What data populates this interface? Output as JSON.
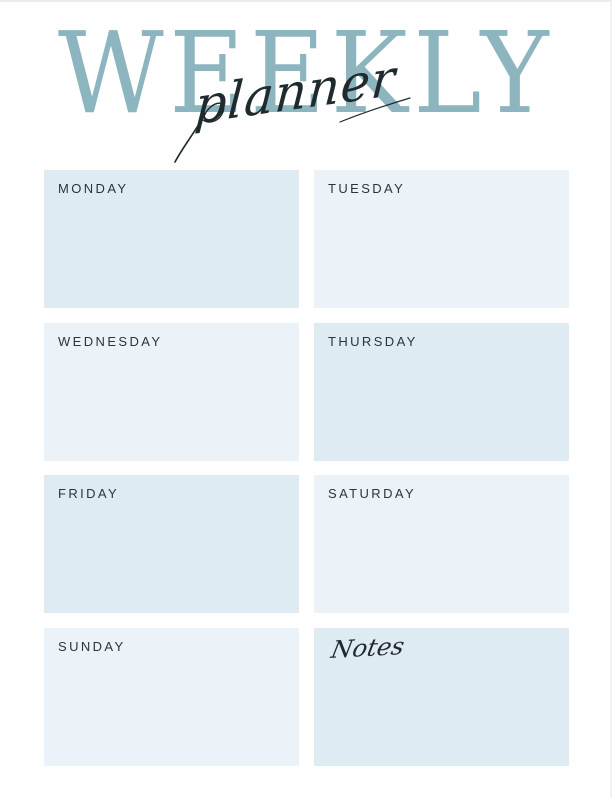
{
  "header": {
    "title": "WEEKLY",
    "subtitle": "planner"
  },
  "days": {
    "monday": "MONDAY",
    "tuesday": "TUESDAY",
    "wednesday": "WEDNESDAY",
    "thursday": "THURSDAY",
    "friday": "FRIDAY",
    "saturday": "SATURDAY",
    "sunday": "SUNDAY"
  },
  "notes": {
    "label": "Notes"
  },
  "colors": {
    "title": "#8db5c0",
    "script": "#1f2a2e",
    "cell_dark": "#deebf2",
    "cell_light": "#ebf3f8"
  }
}
